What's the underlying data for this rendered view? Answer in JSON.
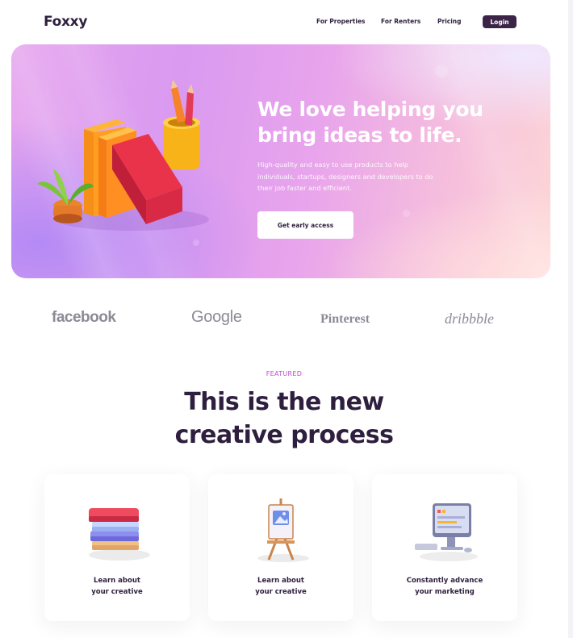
{
  "header": {
    "logo": "Foxxy",
    "nav": [
      "For Properties",
      "For Renters",
      "Pricing"
    ],
    "login_label": "Login"
  },
  "hero": {
    "title_line1": "We love helping you",
    "title_line2": "bring ideas to life.",
    "subtitle_line1": "High-quality and easy to use products to help",
    "subtitle_line2": "individuals, startups, designers and developers to do",
    "subtitle_line3": "their job faster and efficient.",
    "cta_label": "Get early access"
  },
  "brands": [
    "facebook",
    "Google",
    "Pinterest",
    "dribbble"
  ],
  "featured": {
    "eyebrow": "FEATURED",
    "title_line1": "This is the new",
    "title_line2": "creative process"
  },
  "cards": [
    {
      "line1": "Learn about",
      "line2": "your creative",
      "icon": "books-stack-icon"
    },
    {
      "line1": "Learn about",
      "line2": "your creative",
      "icon": "easel-icon"
    },
    {
      "line1": "Constantly advance",
      "line2": "your marketing",
      "icon": "computer-icon"
    }
  ],
  "colors": {
    "brand_dark": "#2e1f3e",
    "accent": "#c04ad8",
    "login_bg": "#3c2448"
  }
}
